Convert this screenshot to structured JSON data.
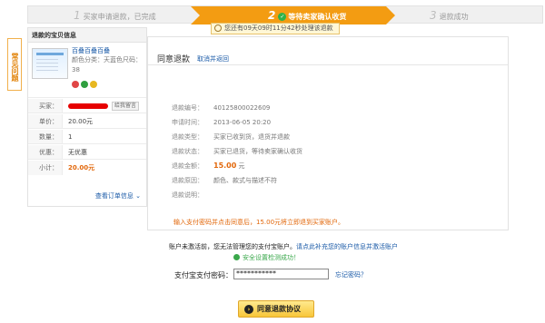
{
  "steps": [
    {
      "num": "1",
      "label": "买家申请退款，已完成"
    },
    {
      "num": "2",
      "label": "等待卖家确认收货"
    },
    {
      "num": "3",
      "label": "退款成功"
    }
  ],
  "countdown": "您还有09天09时11分42秒处理该退款",
  "faq_label": "常见问题",
  "refund_item": {
    "title": "退款的宝贝信息",
    "product_name": "百叠百叠百叠",
    "product_spec": "颜色分类：天蓝色尺码：38",
    "buyer_label": "买家：",
    "message_btn": "给我留言",
    "rows": [
      {
        "label": "单价：",
        "value": "20.00元"
      },
      {
        "label": "数量：",
        "value": "1"
      },
      {
        "label": "优惠：",
        "value": "无优惠"
      },
      {
        "label": "小计：",
        "value": "20.00元"
      }
    ],
    "more_info": "查看订单信息"
  },
  "main": {
    "title": "同意退款",
    "cancel_link": "取消并返回",
    "info_rows": [
      {
        "label": "退款编号：",
        "value": "40125800022609"
      },
      {
        "label": "申请时间：",
        "value": "2013-06-05 20:20"
      },
      {
        "label": "退款类型：",
        "value": "买家已收到货，退货并退款"
      },
      {
        "label": "退款状态：",
        "value": "买家已退货，等待卖家确认收货"
      },
      {
        "label": "退款金额：",
        "value": "15.00",
        "unit": "元"
      },
      {
        "label": "退款原因：",
        "value": "颜色、款式与描述不符"
      },
      {
        "label": "退款说明：",
        "value": ""
      }
    ],
    "notice": "输入支付密码并点击同意后，15.00元将立即退到买家账户。"
  },
  "account_note_prefix": "账户未激活前，您无法管理您的支付宝账户。",
  "account_note_link": "请点此补充您的账户信息并激活账户",
  "safe_note": "安全设置检测成功！",
  "password_label": "支付宝支付密码：",
  "password_value": "***********",
  "forgot_link": "忘记密码？",
  "agree_button": "同意退款协议",
  "colors": {
    "accent": "#f39c12",
    "link": "#1a5aa7",
    "price": "#e2670a"
  }
}
